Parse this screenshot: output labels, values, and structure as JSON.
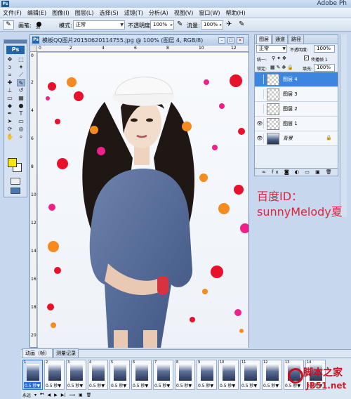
{
  "app": {
    "title": "Adobe Ph",
    "logo": "Ps"
  },
  "menu": [
    "文件(F)",
    "编辑(E)",
    "图像(I)",
    "图层(L)",
    "选择(S)",
    "滤镜(T)",
    "分析(A)",
    "视图(V)",
    "窗口(W)",
    "帮助(H)"
  ],
  "options": {
    "brush_label": "画笔:",
    "brush_size": "30",
    "mode_label": "模式:",
    "mode_value": "正常",
    "opacity_label": "不透明度:",
    "opacity_value": "100%",
    "flow_label": "流量:",
    "flow_value": "100%"
  },
  "document": {
    "title": "模板QQ图片20150620114755.jpg @ 100% (图层 4, RGB/8)",
    "ruler_top": [
      "0",
      "2",
      "4",
      "6",
      "8",
      "10",
      "12"
    ],
    "ruler_left": [
      "0",
      "2",
      "4",
      "6",
      "8",
      "10",
      "12",
      "14",
      "16",
      "18",
      "20"
    ]
  },
  "layers_panel": {
    "tabs": [
      "图层",
      "通道",
      "路径"
    ],
    "blend_mode": "正常",
    "opacity_label": "不透明度:",
    "opacity_value": "100%",
    "unify_label": "统一:",
    "propagate_label": "传播帧 1",
    "lock_label": "锁定:",
    "fill_label": "填充:",
    "fill_value": "100%",
    "layers": [
      {
        "name": "图层 4",
        "visible": false,
        "active": true
      },
      {
        "name": "图层 3",
        "visible": false,
        "active": false
      },
      {
        "name": "图层 2",
        "visible": false,
        "active": false
      },
      {
        "name": "图层 1",
        "visible": true,
        "active": false
      },
      {
        "name": "背景",
        "visible": true,
        "active": false,
        "locked": true
      }
    ]
  },
  "annotation": {
    "line1": "百度ID：",
    "line2": "sunnyMelody夏"
  },
  "animation": {
    "tabs": [
      "动画（帧）",
      "测量记录"
    ],
    "loop_value": "永远",
    "frames": [
      {
        "num": "1",
        "delay": "0.5 秒▼"
      },
      {
        "num": "2",
        "delay": "0.5 秒▼"
      },
      {
        "num": "3",
        "delay": "0.5 秒▼"
      },
      {
        "num": "4",
        "delay": "0.5 秒▼"
      },
      {
        "num": "5",
        "delay": "0.5 秒▼"
      },
      {
        "num": "6",
        "delay": "0.5 秒▼"
      },
      {
        "num": "7",
        "delay": "0.5 秒▼"
      },
      {
        "num": "8",
        "delay": "0.5 秒▼"
      },
      {
        "num": "9",
        "delay": "0.5 秒▼"
      },
      {
        "num": "10",
        "delay": "0.5 秒▼"
      },
      {
        "num": "11",
        "delay": "0.5 秒▼"
      },
      {
        "num": "12",
        "delay": "0.5 秒▼"
      },
      {
        "num": "13",
        "delay": "0.5 秒▼"
      },
      {
        "num": "14",
        "delay": "0.5 秒▼"
      }
    ]
  },
  "watermark": {
    "brand": "脚本之家",
    "url": "JB51.net"
  },
  "colors": {
    "foreground": "#f7e413",
    "background": "#ffffff",
    "dot_red": "#e8102a",
    "dot_pink": "#f0208a",
    "dot_orange": "#f78a1e",
    "annotation": "#e0243a",
    "selection": "#3c86e0"
  }
}
